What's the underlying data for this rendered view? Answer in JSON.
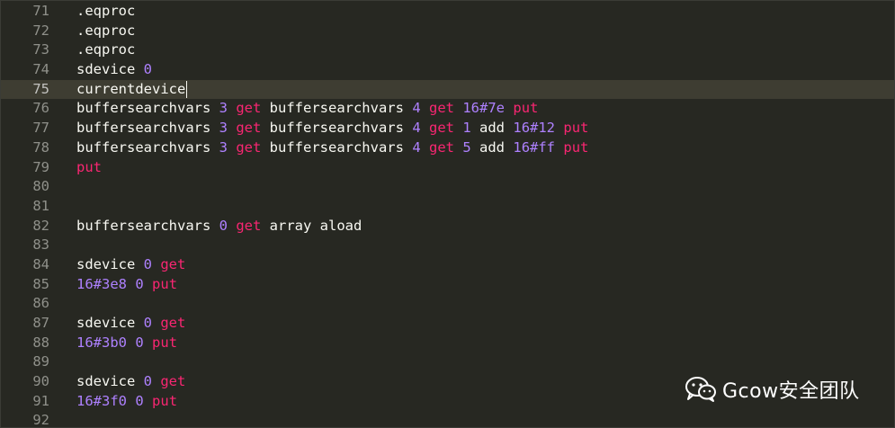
{
  "editor": {
    "active_line": 75,
    "lines": [
      {
        "num": "71",
        "tokens": [
          {
            "t": ".eqproc",
            "c": "plain"
          }
        ]
      },
      {
        "num": "72",
        "tokens": [
          {
            "t": ".eqproc",
            "c": "plain"
          }
        ]
      },
      {
        "num": "73",
        "tokens": [
          {
            "t": ".eqproc",
            "c": "plain"
          }
        ]
      },
      {
        "num": "74",
        "tokens": [
          {
            "t": "sdevice ",
            "c": "plain"
          },
          {
            "t": "0",
            "c": "num"
          }
        ]
      },
      {
        "num": "75",
        "tokens": [
          {
            "t": "currentdevice",
            "c": "plain"
          }
        ],
        "caret": true
      },
      {
        "num": "76",
        "tokens": [
          {
            "t": "buffersearchvars ",
            "c": "plain"
          },
          {
            "t": "3",
            "c": "num"
          },
          {
            "t": " ",
            "c": "plain"
          },
          {
            "t": "get",
            "c": "kw"
          },
          {
            "t": " buffersearchvars ",
            "c": "plain"
          },
          {
            "t": "4",
            "c": "num"
          },
          {
            "t": " ",
            "c": "plain"
          },
          {
            "t": "get",
            "c": "kw"
          },
          {
            "t": " ",
            "c": "plain"
          },
          {
            "t": "16#7e",
            "c": "num"
          },
          {
            "t": " ",
            "c": "plain"
          },
          {
            "t": "put",
            "c": "kw"
          }
        ]
      },
      {
        "num": "77",
        "tokens": [
          {
            "t": "buffersearchvars ",
            "c": "plain"
          },
          {
            "t": "3",
            "c": "num"
          },
          {
            "t": " ",
            "c": "plain"
          },
          {
            "t": "get",
            "c": "kw"
          },
          {
            "t": " buffersearchvars ",
            "c": "plain"
          },
          {
            "t": "4",
            "c": "num"
          },
          {
            "t": " ",
            "c": "plain"
          },
          {
            "t": "get",
            "c": "kw"
          },
          {
            "t": " ",
            "c": "plain"
          },
          {
            "t": "1",
            "c": "num"
          },
          {
            "t": " add ",
            "c": "plain"
          },
          {
            "t": "16#12",
            "c": "num"
          },
          {
            "t": " ",
            "c": "plain"
          },
          {
            "t": "put",
            "c": "kw"
          }
        ]
      },
      {
        "num": "78",
        "tokens": [
          {
            "t": "buffersearchvars ",
            "c": "plain"
          },
          {
            "t": "3",
            "c": "num"
          },
          {
            "t": " ",
            "c": "plain"
          },
          {
            "t": "get",
            "c": "kw"
          },
          {
            "t": " buffersearchvars ",
            "c": "plain"
          },
          {
            "t": "4",
            "c": "num"
          },
          {
            "t": " ",
            "c": "plain"
          },
          {
            "t": "get",
            "c": "kw"
          },
          {
            "t": " ",
            "c": "plain"
          },
          {
            "t": "5",
            "c": "num"
          },
          {
            "t": " add ",
            "c": "plain"
          },
          {
            "t": "16#ff",
            "c": "num"
          },
          {
            "t": " ",
            "c": "plain"
          },
          {
            "t": "put",
            "c": "kw"
          }
        ]
      },
      {
        "num": "79",
        "tokens": [
          {
            "t": "put",
            "c": "kw"
          }
        ]
      },
      {
        "num": "80",
        "tokens": []
      },
      {
        "num": "81",
        "tokens": []
      },
      {
        "num": "82",
        "tokens": [
          {
            "t": "buffersearchvars ",
            "c": "plain"
          },
          {
            "t": "0",
            "c": "num"
          },
          {
            "t": " ",
            "c": "plain"
          },
          {
            "t": "get",
            "c": "kw"
          },
          {
            "t": " array aload",
            "c": "plain"
          }
        ]
      },
      {
        "num": "83",
        "tokens": []
      },
      {
        "num": "84",
        "tokens": [
          {
            "t": "sdevice ",
            "c": "plain"
          },
          {
            "t": "0",
            "c": "num"
          },
          {
            "t": " ",
            "c": "plain"
          },
          {
            "t": "get",
            "c": "kw"
          }
        ]
      },
      {
        "num": "85",
        "tokens": [
          {
            "t": "16#3e8",
            "c": "num"
          },
          {
            "t": " ",
            "c": "plain"
          },
          {
            "t": "0",
            "c": "num"
          },
          {
            "t": " ",
            "c": "plain"
          },
          {
            "t": "put",
            "c": "kw"
          }
        ]
      },
      {
        "num": "86",
        "tokens": []
      },
      {
        "num": "87",
        "tokens": [
          {
            "t": "sdevice ",
            "c": "plain"
          },
          {
            "t": "0",
            "c": "num"
          },
          {
            "t": " ",
            "c": "plain"
          },
          {
            "t": "get",
            "c": "kw"
          }
        ]
      },
      {
        "num": "88",
        "tokens": [
          {
            "t": "16#3b0",
            "c": "num"
          },
          {
            "t": " ",
            "c": "plain"
          },
          {
            "t": "0",
            "c": "num"
          },
          {
            "t": " ",
            "c": "plain"
          },
          {
            "t": "put",
            "c": "kw"
          }
        ]
      },
      {
        "num": "89",
        "tokens": []
      },
      {
        "num": "90",
        "tokens": [
          {
            "t": "sdevice ",
            "c": "plain"
          },
          {
            "t": "0",
            "c": "num"
          },
          {
            "t": " ",
            "c": "plain"
          },
          {
            "t": "get",
            "c": "kw"
          }
        ]
      },
      {
        "num": "91",
        "tokens": [
          {
            "t": "16#3f0",
            "c": "num"
          },
          {
            "t": " ",
            "c": "plain"
          },
          {
            "t": "0",
            "c": "num"
          },
          {
            "t": " ",
            "c": "plain"
          },
          {
            "t": "put",
            "c": "kw"
          }
        ]
      },
      {
        "num": "92",
        "tokens": []
      }
    ]
  },
  "watermark": {
    "text": "Gcow安全团队",
    "icon": "wechat-icon"
  },
  "colors": {
    "background": "#272822",
    "plain": "#f8f8f2",
    "number": "#ae81ff",
    "keyword": "#f92672",
    "gutter": "#8f908a",
    "active_line": "#3e3d32"
  }
}
